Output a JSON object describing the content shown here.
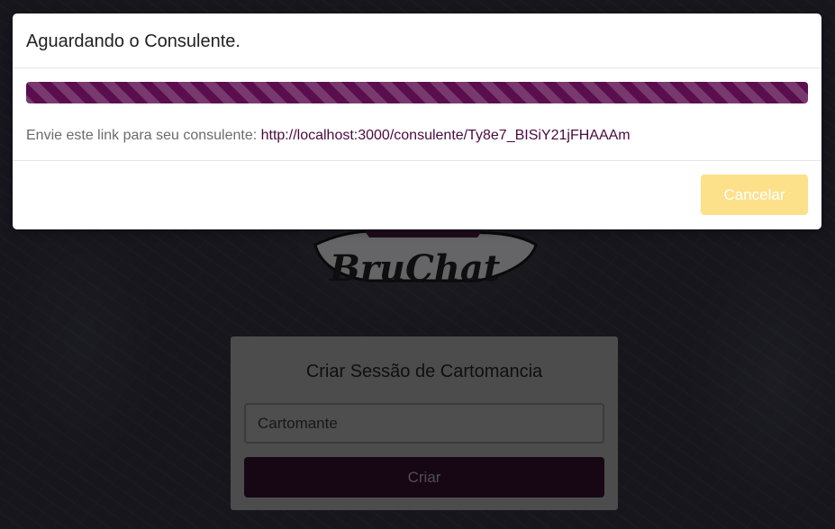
{
  "modal": {
    "title": "Aguardando o Consulente.",
    "progress_percent": 100,
    "link_label": "Envie este link para seu consulente:",
    "link_url": "http://localhost:3000/consulente/Ty8e7_BISiY21jFHAAAm",
    "cancel_label": "Cancelar"
  },
  "logo": {
    "text": "BruChat"
  },
  "session_form": {
    "title": "Criar Sessão de Cartomancia",
    "name_placeholder": "Cartomante",
    "submit_label": "Criar"
  },
  "colors": {
    "brand_purple": "#5a0e4e",
    "link_purple": "#4a0b3e",
    "cancel_yellow": "#fde08a",
    "button_dark": "#2b0c24"
  }
}
